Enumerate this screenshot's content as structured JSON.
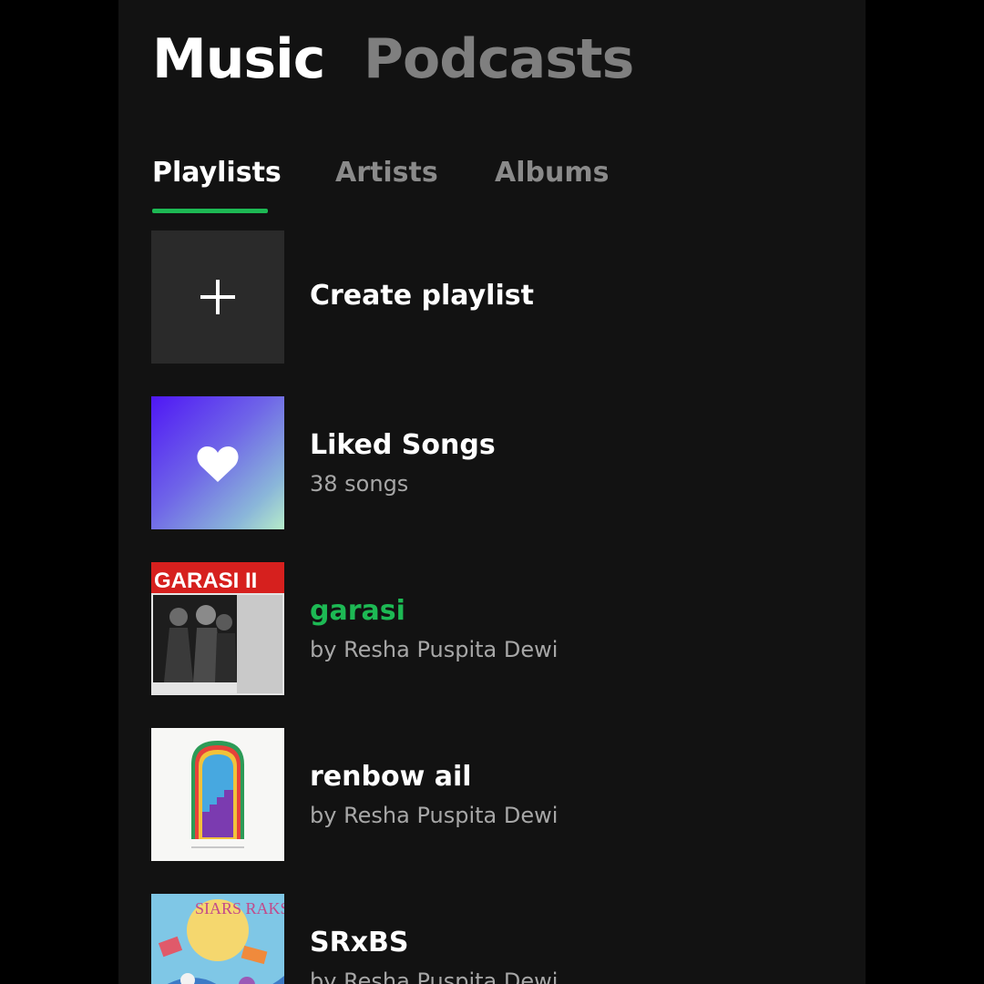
{
  "top_tabs": [
    {
      "label": "Music",
      "active": true
    },
    {
      "label": "Podcasts",
      "active": false
    }
  ],
  "sub_tabs": [
    {
      "label": "Playlists",
      "active": true
    },
    {
      "label": "Artists",
      "active": false
    },
    {
      "label": "Albums",
      "active": false
    }
  ],
  "colors": {
    "accent": "#1db954",
    "background": "#121212",
    "secondary_text": "#a7a7a7"
  },
  "items": [
    {
      "title": "Create playlist",
      "icon": "plus-icon"
    },
    {
      "title": "Liked Songs",
      "subtitle": "38 songs",
      "icon": "heart-icon"
    },
    {
      "title": "garasi",
      "subtitle": "by Resha Puspita Dewi",
      "cover_text": "GARASI II",
      "playing": true
    },
    {
      "title": "renbow ail",
      "subtitle": "by Resha Puspita Dewi"
    },
    {
      "title": "SRxBS",
      "subtitle": "by Resha Puspita Dewi",
      "cover_text": "SIARS RAKSH"
    }
  ]
}
